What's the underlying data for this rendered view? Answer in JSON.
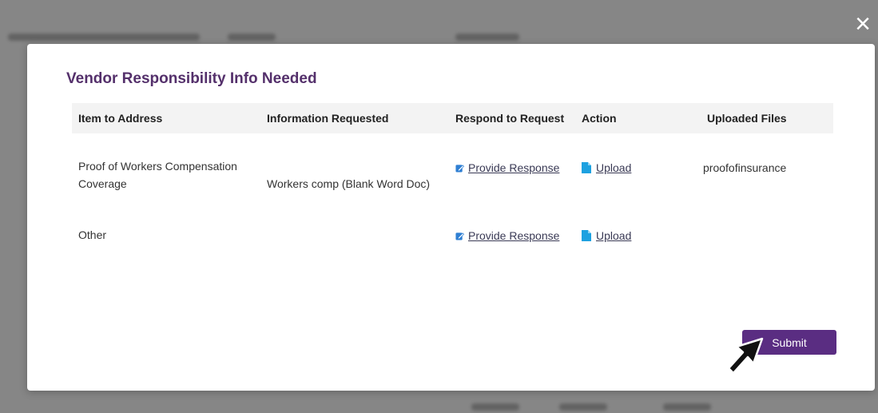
{
  "modal": {
    "title": "Vendor Responsibility Info Needed",
    "columns": [
      "Item to Address",
      "Information Requested",
      "Respond to Request",
      "Action",
      "Uploaded Files"
    ],
    "rows": [
      {
        "item_line1": "Proof of Workers Compensation",
        "item_line2": "Coverage",
        "information": "Workers comp (Blank Word Doc)",
        "respond_label": "Provide Response",
        "action_label": "Upload",
        "uploaded_file": "proofofinsurance"
      },
      {
        "item_line1": "Other",
        "item_line2": "",
        "information": "",
        "respond_label": "Provide Response",
        "action_label": "Upload",
        "uploaded_file": ""
      }
    ],
    "submit_label": "Submit",
    "close_label": "×"
  },
  "colors": {
    "title": "#54306b",
    "submit": "#5a2d82",
    "file_icon": "#1da1e0",
    "response_icon": "#2f7fd3"
  },
  "icons": {
    "close": "close-icon",
    "respond": "edit-response-icon",
    "upload": "file-icon",
    "cursor": "mouse-pointer-icon"
  }
}
